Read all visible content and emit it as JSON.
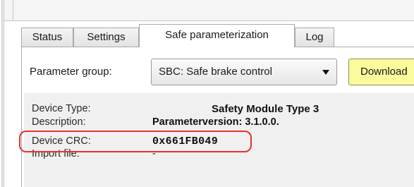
{
  "tabs": [
    {
      "label": "Status",
      "active": false
    },
    {
      "label": "Settings",
      "active": false
    },
    {
      "label": "Safe parameterization",
      "active": true
    },
    {
      "label": "Log",
      "active": false
    }
  ],
  "parameter_group": {
    "label": "Parameter group:",
    "selected": "SBC: Safe brake control",
    "arrow_icon": "dropdown-arrow-icon"
  },
  "download_button": {
    "label": "Download",
    "color": "#fbfb9c"
  },
  "device_info": {
    "device_type_label": "Device Type:",
    "device_type_value": "Safety Module Type 3",
    "description_label": "Description:",
    "description_value": "Parameterversion: 3.1.0.0.",
    "crc_label": "Device CRC:",
    "crc_value": "0x661FB049",
    "import_label": "Import file:",
    "import_value": "-"
  },
  "colors": {
    "highlight": "#e8332c",
    "panel": "#f0f0f0"
  }
}
